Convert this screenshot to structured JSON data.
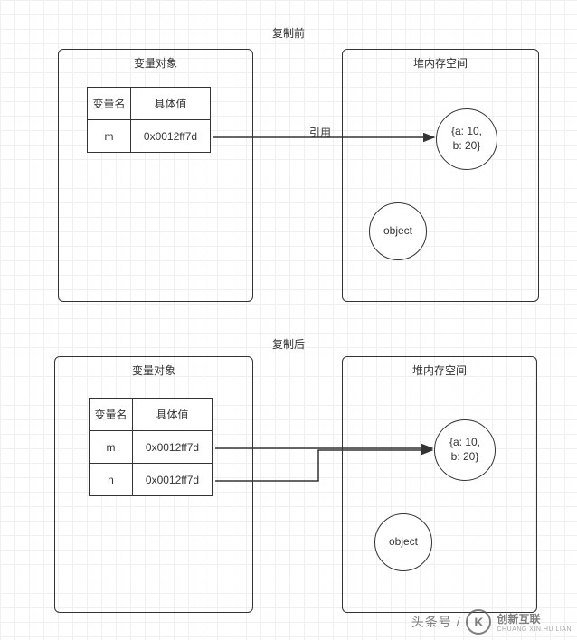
{
  "diagram": {
    "before": {
      "title": "复制前",
      "var_box_title": "变量对象",
      "heap_box_title": "堆内存空间",
      "table": {
        "headers": {
          "name": "变量名",
          "value": "具体值"
        },
        "rows": [
          {
            "name": "m",
            "value": "0x0012ff7d"
          }
        ]
      },
      "arrow_label": "引用",
      "heap_obj1": "{a: 10,\nb: 20}",
      "heap_obj2": "object"
    },
    "after": {
      "title": "复制后",
      "var_box_title": "变量对象",
      "heap_box_title": "堆内存空间",
      "table": {
        "headers": {
          "name": "变量名",
          "value": "具体值"
        },
        "rows": [
          {
            "name": "m",
            "value": "0x0012ff7d"
          },
          {
            "name": "n",
            "value": "0x0012ff7d"
          }
        ]
      },
      "heap_obj1": "{a: 10,\nb: 20}",
      "heap_obj2": "object"
    }
  },
  "watermark": {
    "prefix": "头条号 /",
    "brand": "创新互联",
    "sub": "CHUANG XIN HU LIAN"
  }
}
